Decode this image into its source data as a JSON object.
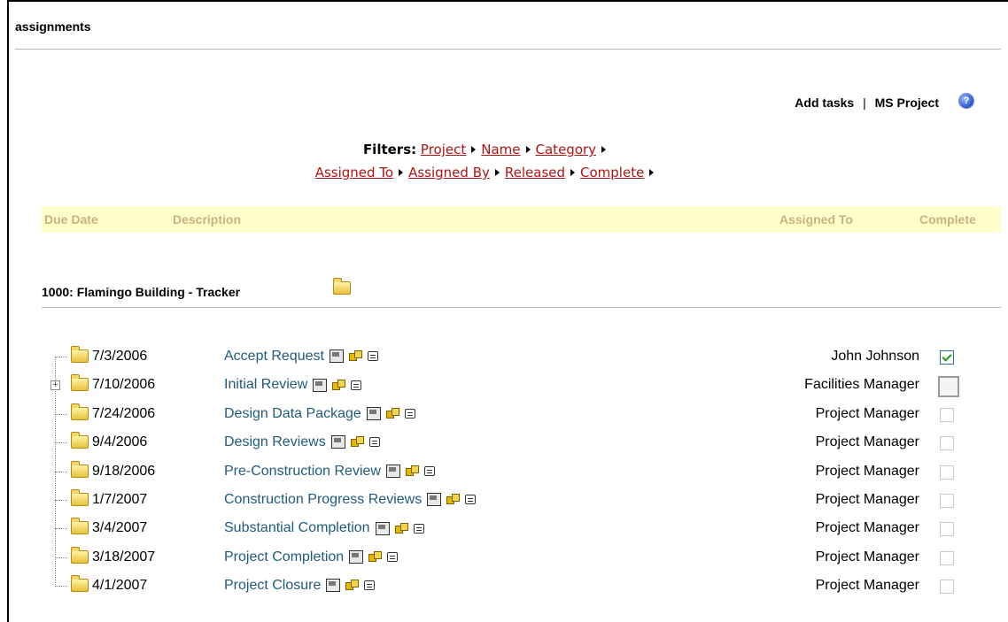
{
  "panel": {
    "title": "assignments"
  },
  "toplinks": {
    "add_tasks": "Add tasks",
    "separator": "|",
    "ms_project": "MS Project",
    "help_icon": "help-icon"
  },
  "filters": {
    "label": "Filters:",
    "line1": [
      "Project",
      "Name",
      "Category"
    ],
    "line2": [
      "Assigned To",
      "Assigned By",
      "Released",
      "Complete"
    ]
  },
  "columns": {
    "due_date": "Due Date",
    "description": "Description",
    "assigned_to": "Assigned To",
    "complete": "Complete"
  },
  "group": {
    "title": "1000: Flamingo Building  -  Tracker",
    "icon": "folder-icon"
  },
  "tasks": [
    {
      "date": "7/3/2006",
      "description": "Accept Request",
      "assigned_to": "John Johnson",
      "complete": true,
      "expandable": false
    },
    {
      "date": "7/10/2006",
      "description": "Initial Review",
      "assigned_to": "Facilities Manager",
      "complete": false,
      "expandable": true
    },
    {
      "date": "7/24/2006",
      "description": "Design Data Package",
      "assigned_to": "Project Manager",
      "complete": false,
      "expandable": false
    },
    {
      "date": "9/4/2006",
      "description": "Design Reviews",
      "assigned_to": "Project Manager",
      "complete": false,
      "expandable": false
    },
    {
      "date": "9/18/2006",
      "description": "Pre-Construction Review",
      "assigned_to": "Project Manager",
      "complete": false,
      "expandable": false
    },
    {
      "date": "1/7/2007",
      "description": "Construction Progress Reviews",
      "assigned_to": "Project Manager",
      "complete": false,
      "expandable": false
    },
    {
      "date": "3/4/2007",
      "description": "Substantial Completion",
      "assigned_to": "Project Manager",
      "complete": false,
      "expandable": false
    },
    {
      "date": "3/18/2007",
      "description": "Project Completion",
      "assigned_to": "Project Manager",
      "complete": false,
      "expandable": false
    },
    {
      "date": "4/1/2007",
      "description": "Project Closure",
      "assigned_to": "Project Manager",
      "complete": false,
      "expandable": false
    }
  ],
  "colors": {
    "link_red": "#b01414",
    "desc_teal": "#1f5b7a",
    "header_bg": "#ffffcc",
    "header_text": "#c8b27a",
    "check_green": "#1a9a1a"
  }
}
